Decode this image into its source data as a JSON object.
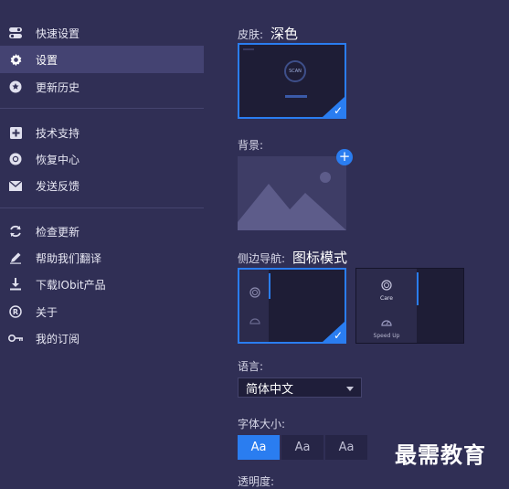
{
  "sidebar": {
    "items": [
      {
        "label": "快速设置",
        "icon": "toggle-icon"
      },
      {
        "label": "设置",
        "icon": "gear-icon"
      },
      {
        "label": "更新历史",
        "icon": "star-icon"
      },
      {
        "label": "技术支持",
        "icon": "plus-box-icon"
      },
      {
        "label": "恢复中心",
        "icon": "lifebuoy-icon"
      },
      {
        "label": "发送反馈",
        "icon": "mail-icon"
      },
      {
        "label": "检查更新",
        "icon": "refresh-icon"
      },
      {
        "label": "帮助我们翻译",
        "icon": "pencil-icon"
      },
      {
        "label": "下载IObit产品",
        "icon": "download-icon"
      },
      {
        "label": "关于",
        "icon": "registered-icon"
      },
      {
        "label": "我的订阅",
        "icon": "key-icon"
      }
    ]
  },
  "skin": {
    "label": "皮肤:",
    "value": "深色",
    "preview_text": "SCAN"
  },
  "background": {
    "label": "背景:"
  },
  "sidenav": {
    "label": "侧边导航:",
    "value": "图标模式",
    "option2_items": [
      "Care",
      "Speed Up"
    ]
  },
  "language": {
    "label": "语言:",
    "value": "简体中文"
  },
  "font_size": {
    "label": "字体大小:",
    "options": [
      "Aa",
      "Aa",
      "Aa"
    ]
  },
  "transparency": {
    "label": "透明度:"
  },
  "watermark": "最需教育",
  "colors": {
    "accent": "#2a7df0",
    "sidebar_active": "#444372",
    "bg": "#302f55"
  }
}
